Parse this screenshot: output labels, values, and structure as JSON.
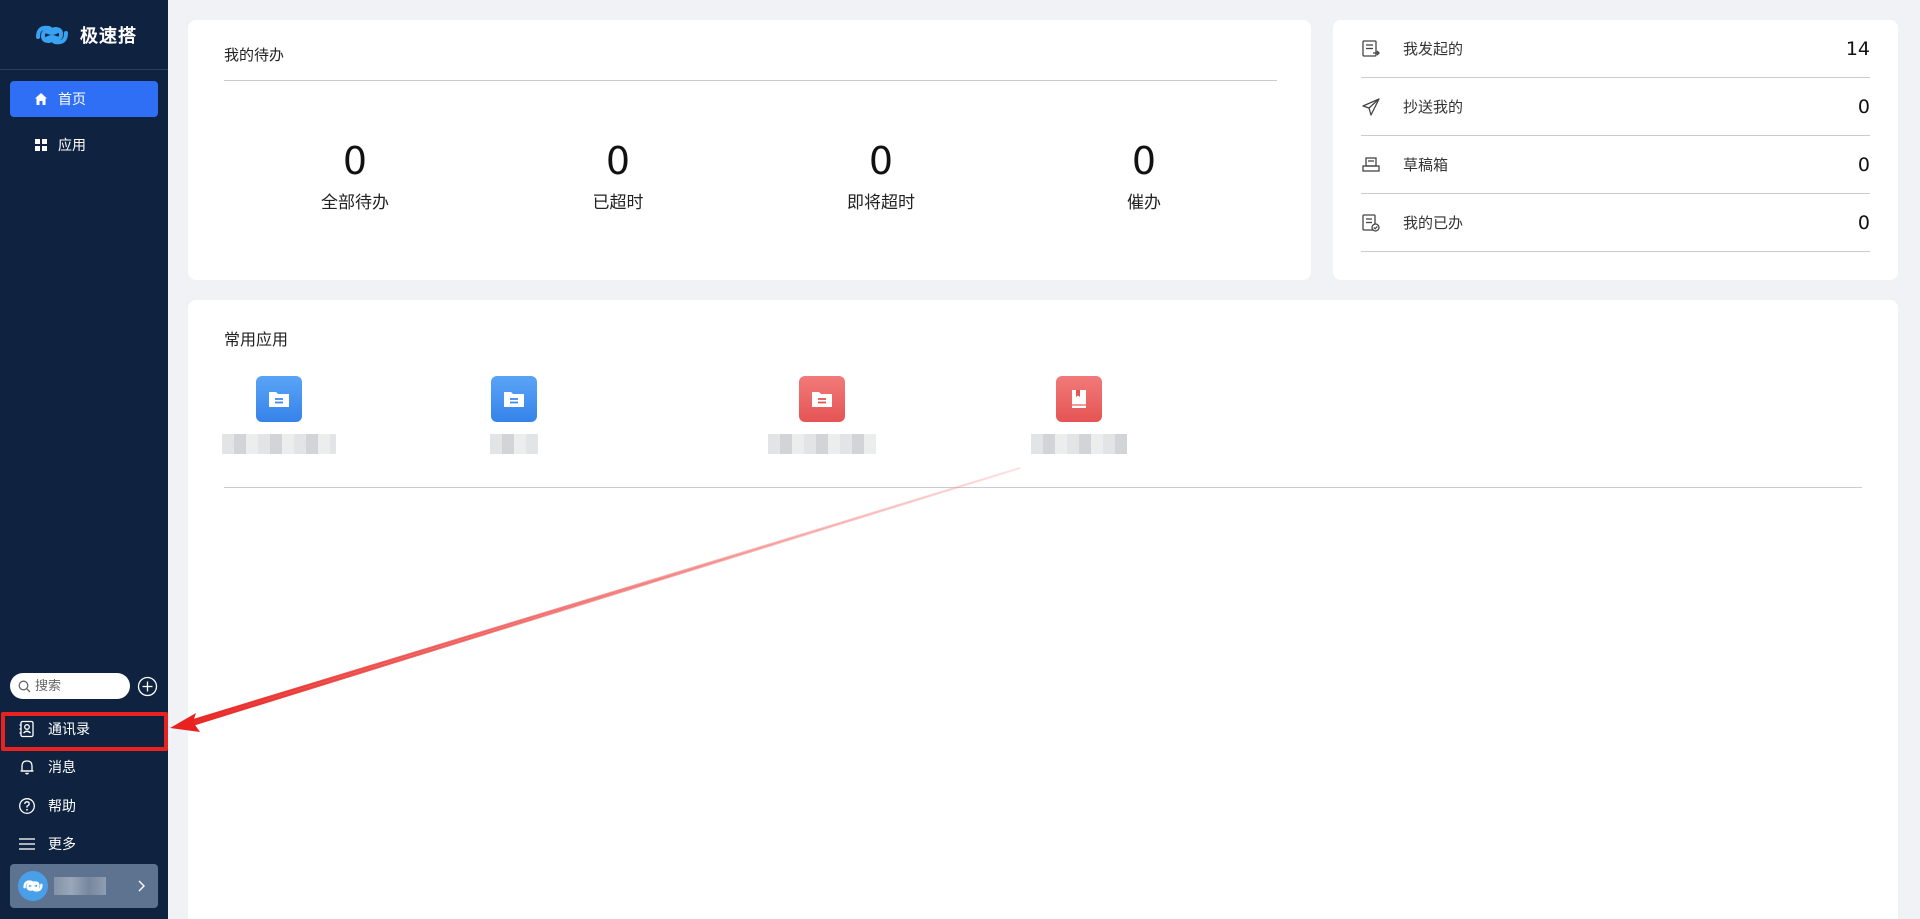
{
  "brand": {
    "name": "极速搭"
  },
  "sidebar": {
    "nav": [
      {
        "label": "首页",
        "icon": "home-icon",
        "active": true
      },
      {
        "label": "应用",
        "icon": "grid-icon",
        "active": false
      }
    ],
    "search": {
      "placeholder": "搜索"
    },
    "bottom": [
      {
        "label": "通讯录",
        "icon": "contacts-icon"
      },
      {
        "label": "消息",
        "icon": "bell-icon"
      },
      {
        "label": "帮助",
        "icon": "help-icon"
      },
      {
        "label": "更多",
        "icon": "menu-icon"
      }
    ]
  },
  "todo": {
    "title": "我的待办",
    "stats": [
      {
        "value": "0",
        "label": "全部待办"
      },
      {
        "value": "0",
        "label": "已超时"
      },
      {
        "value": "0",
        "label": "即将超时"
      },
      {
        "value": "0",
        "label": "催办"
      }
    ]
  },
  "summary": [
    {
      "label": "我发起的",
      "count": "14",
      "icon": "initiated-icon"
    },
    {
      "label": "抄送我的",
      "count": "0",
      "icon": "send-icon"
    },
    {
      "label": "草稿箱",
      "count": "0",
      "icon": "drafts-icon"
    },
    {
      "label": "我的已办",
      "count": "0",
      "icon": "done-icon"
    }
  ],
  "apps": {
    "title": "常用应用",
    "items": [
      {
        "color": "blue",
        "icon": "folder-doc-icon"
      },
      {
        "color": "blue",
        "icon": "folder-doc-icon"
      },
      {
        "color": "red",
        "icon": "folder-doc-icon"
      },
      {
        "color": "red",
        "icon": "book-icon"
      }
    ]
  },
  "colors": {
    "sidebar": "#0f2340",
    "accent": "#2f6ff5",
    "highlight": "#e8231f"
  }
}
